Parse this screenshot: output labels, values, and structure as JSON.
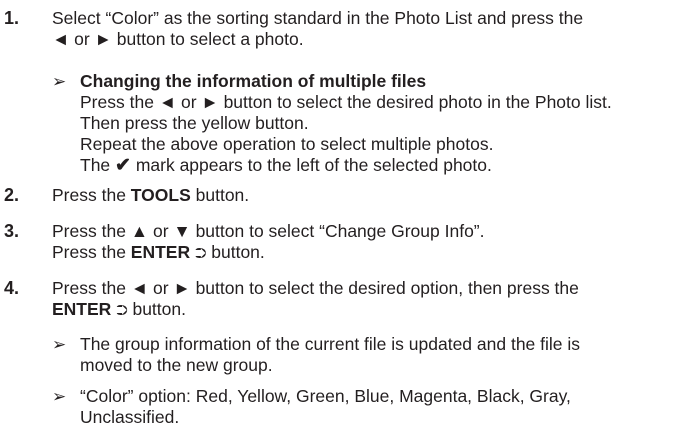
{
  "steps": [
    {
      "num": "1.",
      "lines": [
        "Select “Color” as the sorting standard in the Photo List and press the",
        "◄ or ► button to select a photo."
      ],
      "note": {
        "arrow": "➢",
        "title": "Changing the information of multiple files",
        "lines": [
          "Press the ◄ or ► button to select the desired photo in the Photo list.",
          "Then press the yellow button.",
          "Repeat the above operation to select multiple photos."
        ],
        "check_pre": "The ",
        "check_mark": "✔",
        "check_post": " mark appears to the left of the selected photo."
      }
    },
    {
      "num": "2.",
      "pre": "Press the ",
      "bold": "TOOLS",
      "post": " button."
    },
    {
      "num": "3.",
      "line1": "Press the ▲ or ▼ button to select “Change Group Info”.",
      "pre": "Press the ",
      "bold": "ENTER",
      "enter_icon": "⮊",
      "post": " button."
    },
    {
      "num": "4.",
      "line1": "Press the ◄ or ► button to select the desired option, then press the",
      "bold": "ENTER",
      "enter_icon": "⮊",
      "post": " button.",
      "notes": [
        {
          "arrow": "➢",
          "lines": [
            "The group information of the current file is updated and the file is",
            "moved to the new group."
          ]
        },
        {
          "arrow": "➢",
          "lines": [
            "“Color” option: Red, Yellow, Green, Blue, Magenta, Black, Gray,",
            "Unclassified."
          ]
        }
      ]
    }
  ]
}
